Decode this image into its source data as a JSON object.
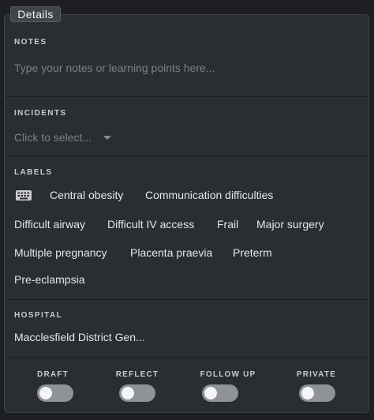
{
  "details": {
    "tab_label": "Details",
    "notes": {
      "title": "NOTES",
      "placeholder": "Type your notes or learning points here..."
    },
    "incidents": {
      "title": "INCIDENTS",
      "placeholder": "Click to select..."
    },
    "labels": {
      "title": "LABELS",
      "icon": "keyboard-icon",
      "items": [
        "Central obesity",
        "Communication difficulties",
        "Difficult airway",
        "Difficult IV access",
        "Frail",
        "Major surgery",
        "Multiple pregnancy",
        "Placenta praevia",
        "Preterm",
        "Pre-eclampsia"
      ]
    },
    "hospital": {
      "title": "HOSPITAL",
      "value": "Macclesfield District Gen..."
    },
    "toggles": [
      {
        "label": "DRAFT",
        "on": false
      },
      {
        "label": "REFLECT",
        "on": false
      },
      {
        "label": "FOLLOW UP",
        "on": false
      },
      {
        "label": "PRIVATE",
        "on": false
      }
    ]
  },
  "colors": {
    "background": "#1d1f23",
    "panel": "#2a2d31",
    "text": "#e6e7e9",
    "placeholder": "#7d8186",
    "switch_off": "#8f9398"
  }
}
